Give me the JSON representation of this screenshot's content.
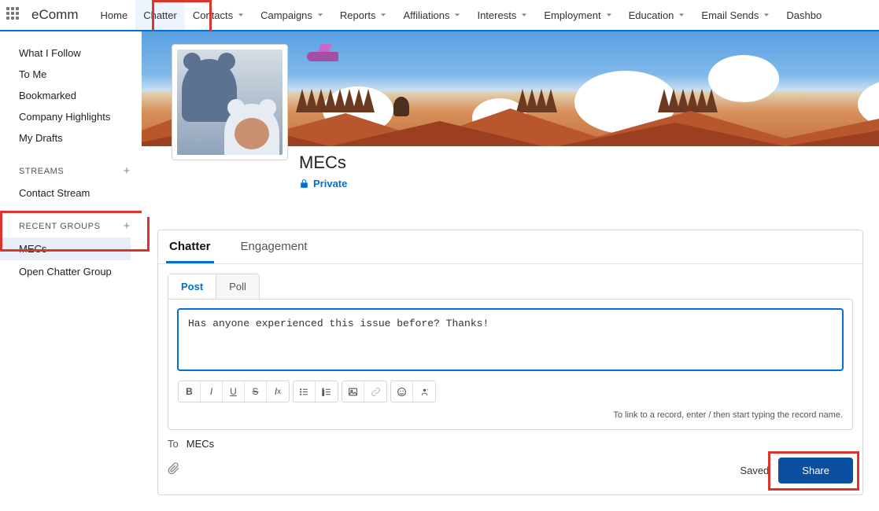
{
  "app_name": "eComm",
  "nav": [
    {
      "label": "Home",
      "dropdown": false
    },
    {
      "label": "Chatter",
      "dropdown": false,
      "active": true
    },
    {
      "label": "Contacts",
      "dropdown": true
    },
    {
      "label": "Campaigns",
      "dropdown": true
    },
    {
      "label": "Reports",
      "dropdown": true
    },
    {
      "label": "Affiliations",
      "dropdown": true
    },
    {
      "label": "Interests",
      "dropdown": true
    },
    {
      "label": "Employment",
      "dropdown": true
    },
    {
      "label": "Education",
      "dropdown": true
    },
    {
      "label": "Email Sends",
      "dropdown": true
    },
    {
      "label": "Dashbo",
      "dropdown": false
    }
  ],
  "sidebar": {
    "feeds": [
      "What I Follow",
      "To Me",
      "Bookmarked",
      "Company Highlights",
      "My Drafts"
    ],
    "streams_head": "STREAMS",
    "streams": [
      "Contact Stream"
    ],
    "recent_head": "RECENT GROUPS",
    "recent": [
      {
        "label": "MECs",
        "selected": true
      },
      {
        "label": "Open Chatter Group",
        "selected": false
      }
    ]
  },
  "group": {
    "title": "MECs",
    "privacy": "Private"
  },
  "tabs_outer": [
    {
      "label": "Chatter",
      "active": true
    },
    {
      "label": "Engagement",
      "active": false
    }
  ],
  "compose_tabs": [
    {
      "label": "Post",
      "active": true
    },
    {
      "label": "Poll",
      "active": false
    }
  ],
  "editor_text": "Has anyone experienced this issue before? Thanks!",
  "link_hint": "To link to a record, enter / then start typing the record name.",
  "to_label": "To",
  "to_value": "MECs",
  "saved_label": "Saved",
  "share_label": "Share"
}
